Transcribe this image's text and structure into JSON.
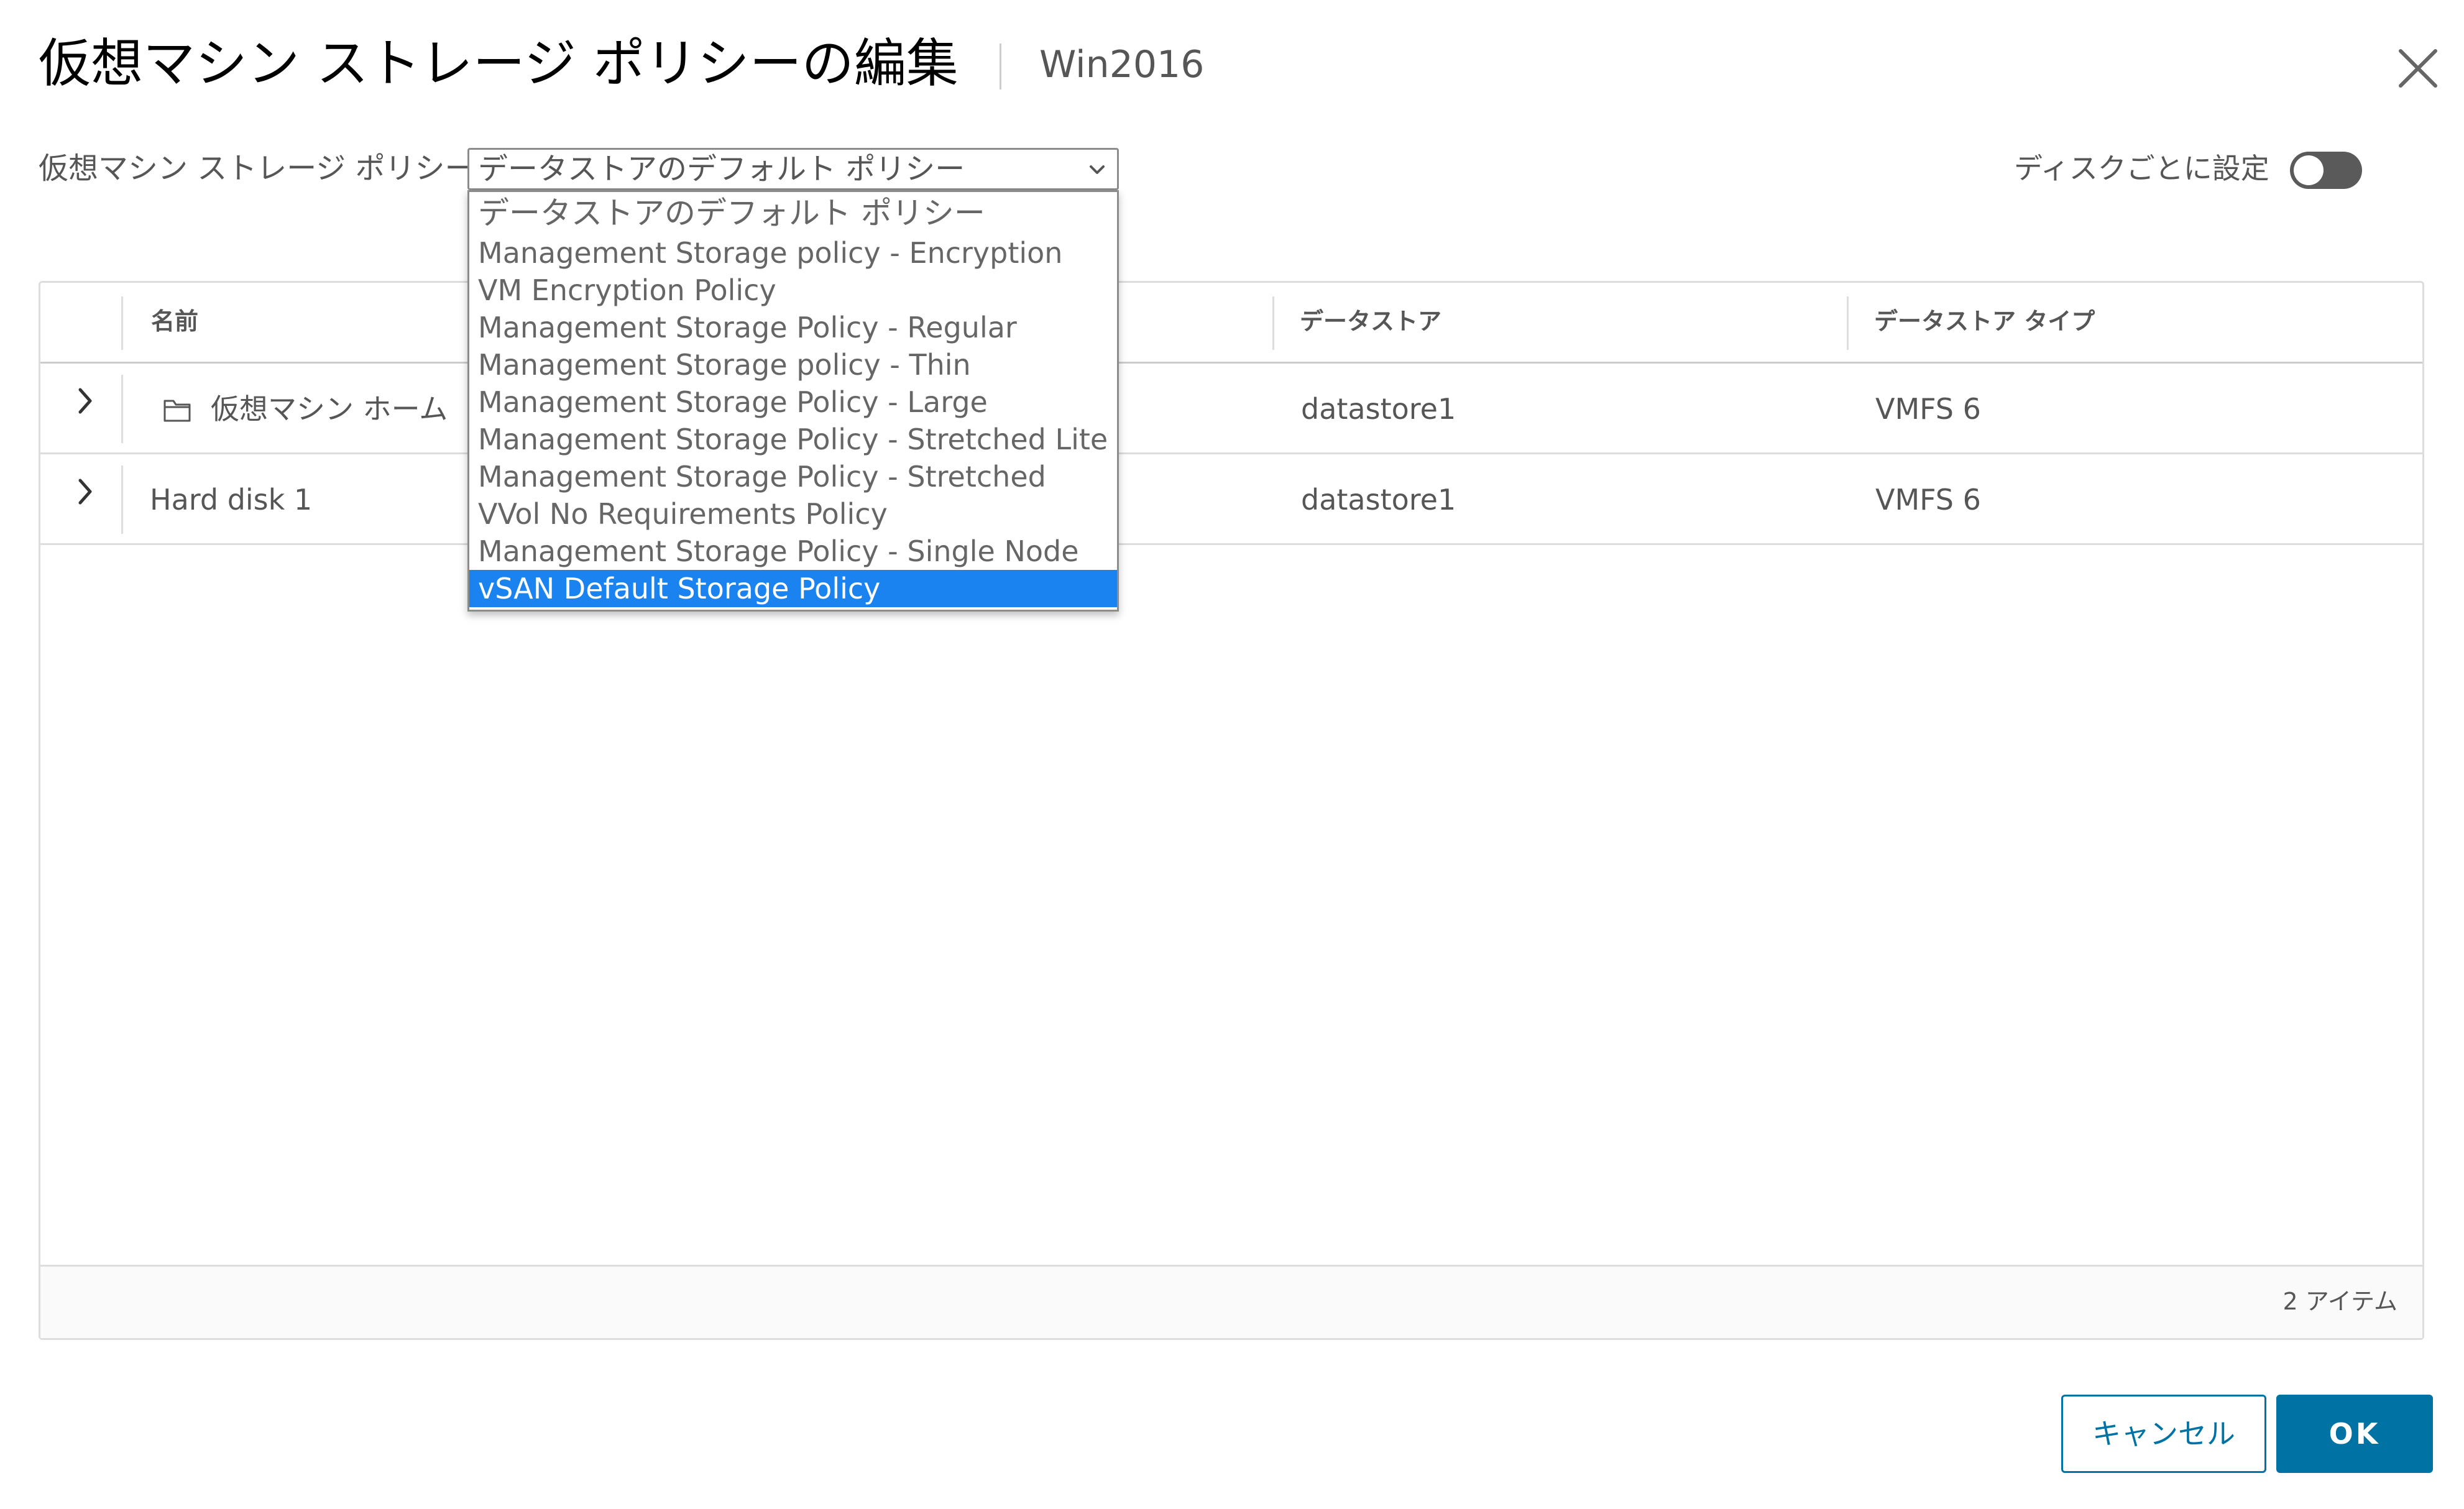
{
  "dialog": {
    "title": "仮想マシン ストレージ ポリシーの編集",
    "subtitle": "Win2016"
  },
  "policy": {
    "label": "仮想マシン ストレージ ポリシー:",
    "selected_value": "データストアのデフォルト ポリシー",
    "options": [
      "データストアのデフォルト ポリシー",
      "Management Storage policy - Encryption",
      "VM Encryption Policy",
      "Management Storage Policy - Regular",
      "Management Storage policy - Thin",
      "Management Storage Policy - Large",
      "Management Storage Policy - Stretched Lite",
      "Management Storage Policy - Stretched",
      "VVol No Requirements Policy",
      "Management Storage Policy - Single Node",
      "vSAN Default Storage Policy"
    ],
    "highlighted_option": "vSAN Default Storage Policy"
  },
  "per_disk": {
    "label": "ディスクごとに設定",
    "enabled": false
  },
  "grid": {
    "columns": [
      "名前",
      "データストア",
      "データストア タイプ"
    ],
    "rows": [
      {
        "name": "仮想マシン ホーム",
        "datastore": "datastore1",
        "type": "VMFS 6",
        "icon": "folder-icon"
      },
      {
        "name": "Hard disk 1",
        "datastore": "datastore1",
        "type": "VMFS 6"
      }
    ],
    "item_count": "2 アイテム"
  },
  "buttons": {
    "cancel": "キャンセル",
    "ok": "OK"
  },
  "colors": {
    "primary": "#0072a3",
    "highlight": "#1a83f0",
    "toggle_off": "#5a5a5a"
  }
}
